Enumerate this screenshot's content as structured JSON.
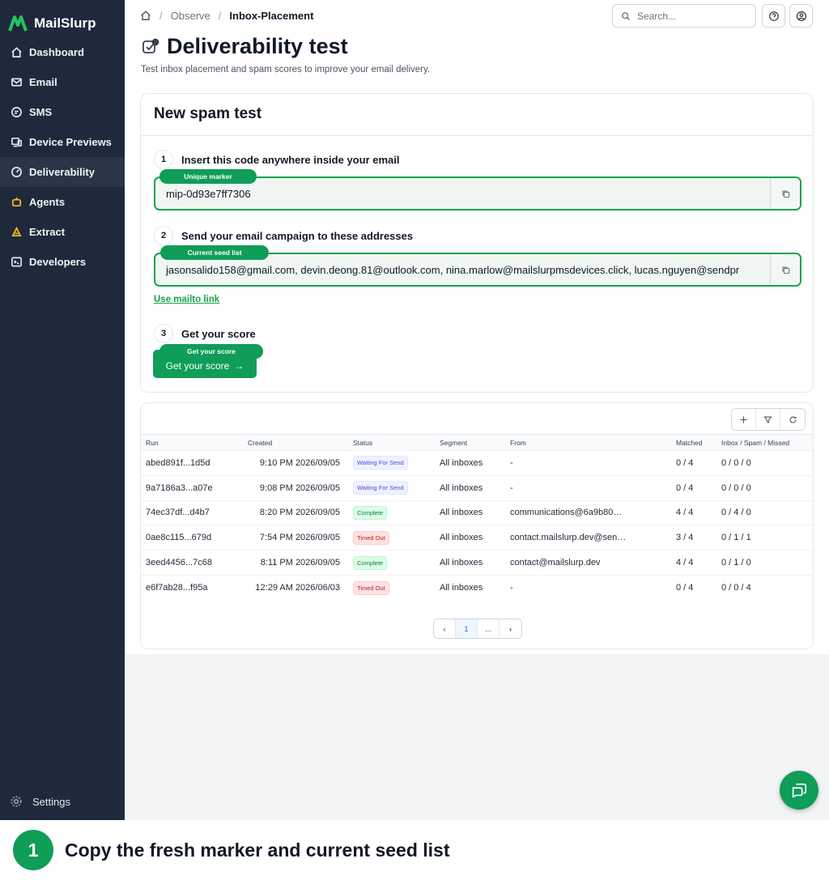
{
  "app": {
    "name": "MailSlurp"
  },
  "sidebar": {
    "items": [
      {
        "label": "Dashboard",
        "icon": "home-icon"
      },
      {
        "label": "Email",
        "icon": "mail-icon"
      },
      {
        "label": "SMS",
        "icon": "chat-icon"
      },
      {
        "label": "Device Previews",
        "icon": "devices-icon"
      },
      {
        "label": "Deliverability",
        "icon": "gauge-icon",
        "active": true
      },
      {
        "label": "Agents",
        "icon": "robot-icon"
      },
      {
        "label": "Extract",
        "icon": "extract-icon"
      },
      {
        "label": "Developers",
        "icon": "terminal-icon"
      }
    ],
    "settings_label": "Settings"
  },
  "breadcrumb": {
    "items": [
      "Observe",
      "Inbox-Placement"
    ]
  },
  "search": {
    "placeholder": "Search..."
  },
  "page": {
    "title": "Deliverability test",
    "subtitle": "Test inbox placement and spam scores to improve your email delivery."
  },
  "spam_test": {
    "heading": "New spam test",
    "step1": {
      "num": "1",
      "label": "Insert this code anywhere inside your email",
      "pill": "Unique marker",
      "value": "mip-0d93e7ff7306"
    },
    "step2": {
      "num": "2",
      "label": "Send your email campaign to these addresses",
      "pill": "Current seed list",
      "value": "jasonsalido158@gmail.com, devin.deong.81@outlook.com, nina.marlow@mailslurpmsdevices.click, lucas.nguyen@sendpr"
    },
    "mailto_label": "Use mailto link",
    "step3": {
      "num": "3",
      "label": "Get your score",
      "pill": "Get your score",
      "button": "Get your score"
    }
  },
  "runs_table": {
    "columns": [
      "Run",
      "Created",
      "Status",
      "Segment",
      "From",
      "Matched",
      "Inbox / Spam / Missed"
    ],
    "rows": [
      {
        "run": "abed891f...1d5d",
        "created": "9:10 PM 2026/09/05",
        "status": "Waiting For Send",
        "status_kind": "wait",
        "segment": "All inboxes",
        "from": "-",
        "matched": "0 / 4",
        "ism": "0 / 0 / 0"
      },
      {
        "run": "9a7186a3...a07e",
        "created": "9:08 PM 2026/09/05",
        "status": "Waiting For Send",
        "status_kind": "wait",
        "segment": "All inboxes",
        "from": "-",
        "matched": "0 / 4",
        "ism": "0 / 0 / 0"
      },
      {
        "run": "74ec37df...d4b7",
        "created": "8:20 PM 2026/09/05",
        "status": "Complete",
        "status_kind": "complete",
        "segment": "All inboxes",
        "from": "communications@6a9b80…",
        "matched": "4 / 4",
        "ism": "0 / 4 / 0"
      },
      {
        "run": "0ae8c115...679d",
        "created": "7:54 PM 2026/09/05",
        "status": "Timed Out",
        "status_kind": "timeout",
        "segment": "All inboxes",
        "from": "contact.mailslurp.dev@sen…",
        "matched": "3 / 4",
        "ism": "0 / 1 / 1"
      },
      {
        "run": "3eed4456...7c68",
        "created": "8:11 PM 2026/09/05",
        "status": "Complete",
        "status_kind": "complete",
        "segment": "All inboxes",
        "from": "contact@mailslurp.dev",
        "matched": "4 / 4",
        "ism": "0 / 1 / 0"
      },
      {
        "run": "e6f7ab28...f95a",
        "created": "12:29 AM 2026/06/03",
        "status": "Timed Out",
        "status_kind": "timeout",
        "segment": "All inboxes",
        "from": "-",
        "matched": "0 / 4",
        "ism": "0 / 0 / 4"
      }
    ],
    "pagination": {
      "current": "1",
      "ellipsis": "..."
    }
  },
  "caption": {
    "step": "1",
    "text": "Copy the fresh marker and current seed list"
  },
  "colors": {
    "sidebar_bg": "#1e293b",
    "accent_green": "#0f9d58",
    "field_border": "#16a34a"
  }
}
